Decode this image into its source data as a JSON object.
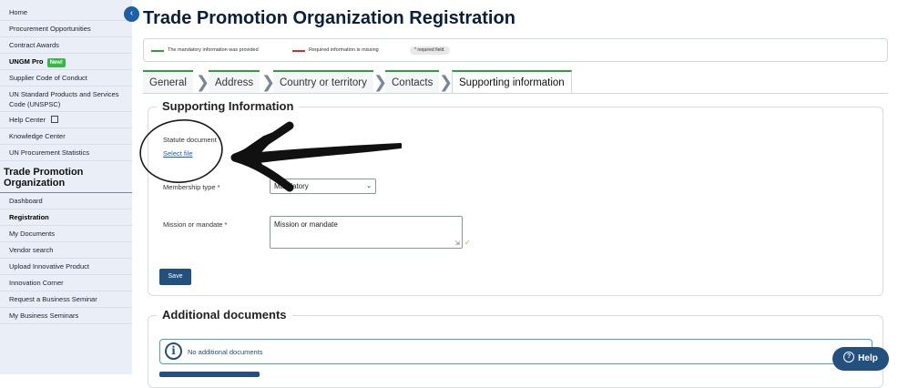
{
  "sidebar": {
    "top_items": [
      {
        "label": "Home"
      },
      {
        "label": "Procurement Opportunities"
      },
      {
        "label": "Contract Awards"
      },
      {
        "label": "UNGM Pro",
        "badge": "New!"
      },
      {
        "label": "Supplier Code of Conduct"
      },
      {
        "label": "UN Standard Products and Services Code (UNSPSC)"
      },
      {
        "label": "Help Center"
      },
      {
        "label": "Knowledge Center"
      },
      {
        "label": "UN Procurement Statistics"
      }
    ],
    "org_title": "Trade Promotion Organization",
    "org_items": [
      {
        "label": "Dashboard"
      },
      {
        "label": "Registration"
      },
      {
        "label": "My Documents"
      },
      {
        "label": "Vendor search"
      },
      {
        "label": "Upload Innovative Product"
      },
      {
        "label": "Innovation Corner"
      },
      {
        "label": "Request a Business Seminar"
      },
      {
        "label": "My Business Seminars"
      }
    ]
  },
  "page": {
    "title": "Trade Promotion Organization Registration"
  },
  "legend": {
    "provided": "The mandatory information was provided",
    "missing": "Required information is missing",
    "required": "* required field.",
    "provided_color": "#2aa13d",
    "missing_color": "#d62c2c"
  },
  "tabs": [
    {
      "label": "General"
    },
    {
      "label": "Address"
    },
    {
      "label": "Country or territory"
    },
    {
      "label": "Contacts"
    },
    {
      "label": "Supporting information"
    }
  ],
  "supporting": {
    "title": "Supporting Information",
    "statute_label": "Statute document *",
    "select_file": "Select file",
    "membership_label": "Membership type *",
    "membership_value": "Mandatory",
    "mission_label": "Mission or mandate *",
    "mission_value": "Mission or mandate",
    "save": "Save"
  },
  "additional": {
    "title": "Additional documents",
    "info": "No additional documents"
  },
  "help": {
    "label": "Help"
  }
}
